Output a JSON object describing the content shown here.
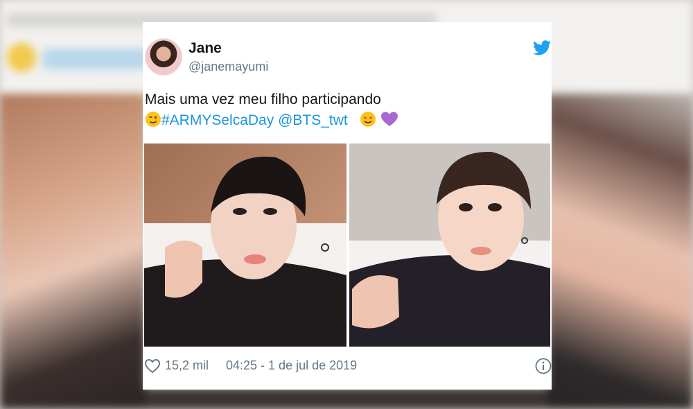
{
  "tweet": {
    "author_name": "Jane",
    "handle": "@janemayumi",
    "text_line1": "Mais uma vez meu filho participando",
    "hashtag": "#ARMYSelcaDay",
    "mention": "@BTS_twt",
    "likes": "15,2 mil",
    "timestamp": "04:25 - 1 de jul de 2019"
  },
  "icons": {
    "brand": "twitter-bird-icon",
    "like": "heart-icon",
    "info": "info-icon",
    "emoji1": "winking-face-emoji",
    "emoji2": "smiling-face-with-heart-eyes-emoji",
    "emoji3": "purple-heart-emoji"
  },
  "colors": {
    "twitter_blue": "#1da1f2",
    "link": "#1b95e0",
    "text": "#14171a",
    "muted": "#657786",
    "purple_heart": "#a866d6"
  }
}
